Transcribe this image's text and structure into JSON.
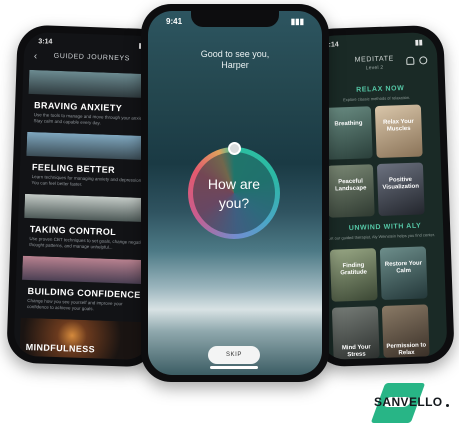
{
  "left_phone": {
    "status": {
      "time": "3:14"
    },
    "nav_title": "GUIDED JOURNEYS",
    "cards": [
      {
        "title": "BRAVING ANXIETY",
        "desc": "Use the tools to manage and move through your anxiety. Stay calm and capable every day.",
        "colors": [
          "#6c8b91",
          "#2f3b3f"
        ]
      },
      {
        "title": "FEELING BETTER",
        "desc": "Learn techniques for managing anxiety and depression. You can feel better faster.",
        "colors": [
          "#7fa7bf",
          "#3b4c55"
        ]
      },
      {
        "title": "TAKING CONTROL",
        "desc": "Use proven CBT techniques to set goals, change negative thought patterns, and manage unhelpful...",
        "colors": [
          "#c4cbc7",
          "#4e5a58"
        ]
      },
      {
        "title": "BUILDING CONFIDENCE",
        "desc": "Change how you see yourself and improve your confidence to achieve your goals.",
        "colors": [
          "#b8818f",
          "#4c4054"
        ]
      },
      {
        "title": "MINDFULNESS",
        "desc": "",
        "colors": [
          "#3a2a22",
          "#1a1412"
        ]
      }
    ]
  },
  "middle_phone": {
    "status": {
      "time": "9:41"
    },
    "greeting_line1": "Good to see you,",
    "greeting_line2": "Harper",
    "question_line1": "How are",
    "question_line2": "you?",
    "skip_label": "SKIP"
  },
  "right_phone": {
    "status": {
      "time": "3:14"
    },
    "header_title": "MEDITATE",
    "header_sub": "Level 2",
    "section1_title": "RELAX NOW",
    "section1_sub": "Explore classic methods of relaxation.",
    "tiles_row1": [
      {
        "label": "Breathing",
        "color": "#3c5a55"
      },
      {
        "label": "Relax Your Muscles",
        "color": "#c7b196"
      }
    ],
    "tiles_row2": [
      {
        "label": "Peaceful Landscape",
        "color": "#4d5a4c"
      },
      {
        "label": "Positive Visualization",
        "color": "#3a3f4a"
      }
    ],
    "section2_title": "UNWIND WITH ALY",
    "section2_sub": "Let our guided therapist, Aly Weinstein helps you find center.",
    "tiles_row3": [
      {
        "label": "Finding Gratitude",
        "color": "#5b6a52"
      },
      {
        "label": "Restore Your Calm",
        "color": "#3e5a5a"
      }
    ],
    "tiles_row4": [
      {
        "label": "Mind Your Stress",
        "color": "#4a4f4c"
      },
      {
        "label": "Permission to Relax",
        "color": "#5a4e42"
      }
    ]
  },
  "logo": {
    "text": "SANVELLO",
    "color": "#28b586"
  }
}
